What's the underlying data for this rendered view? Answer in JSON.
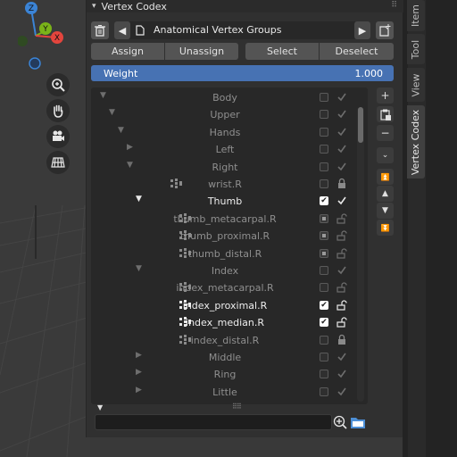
{
  "panel": {
    "title": "Vertex Codex"
  },
  "gizmo": {
    "z": "Z",
    "y": "Y",
    "x": "X"
  },
  "side_tabs": [
    "Item",
    "Tool",
    "View",
    "Vertex Codex"
  ],
  "selector": {
    "name": "Anatomical Vertex Groups"
  },
  "actions": {
    "assign": "Assign",
    "unassign": "Unassign",
    "select": "Select",
    "deselect": "Deselect"
  },
  "weight": {
    "label": "Weight",
    "value": "1.000"
  },
  "tree": [
    {
      "label": "Body",
      "indent": 0,
      "expanded": true,
      "kind": "folder",
      "checked": false,
      "locked": false,
      "active": false
    },
    {
      "label": "Upper",
      "indent": 1,
      "expanded": true,
      "kind": "folder",
      "checked": false,
      "locked": false,
      "active": false
    },
    {
      "label": "Hands",
      "indent": 2,
      "expanded": true,
      "kind": "folder",
      "checked": false,
      "locked": false,
      "active": false
    },
    {
      "label": "Left",
      "indent": 3,
      "expanded": false,
      "kind": "folder",
      "checked": false,
      "locked": false,
      "active": false
    },
    {
      "label": "Right",
      "indent": 3,
      "expanded": true,
      "kind": "folder",
      "checked": false,
      "locked": false,
      "active": false
    },
    {
      "label": "wrist.R",
      "indent": 4,
      "kind": "group",
      "checked": false,
      "locked": true,
      "active": false
    },
    {
      "label": "Thumb",
      "indent": 4,
      "expanded": true,
      "kind": "folder",
      "checked": true,
      "locked": false,
      "active": true
    },
    {
      "label": "thumb_metacarpal.R",
      "indent": 5,
      "kind": "group",
      "checked": "mixed",
      "locked": false,
      "active": false
    },
    {
      "label": "thumb_proximal.R",
      "indent": 5,
      "kind": "group",
      "checked": "mixed",
      "locked": false,
      "active": false
    },
    {
      "label": "thumb_distal.R",
      "indent": 5,
      "kind": "group",
      "checked": "mixed",
      "locked": false,
      "active": false
    },
    {
      "label": "Index",
      "indent": 4,
      "expanded": true,
      "kind": "folder",
      "checked": false,
      "locked": false,
      "active": false
    },
    {
      "label": "index_metacarpal.R",
      "indent": 5,
      "kind": "group",
      "checked": false,
      "locked": false,
      "active": false
    },
    {
      "label": "index_proximal.R",
      "indent": 5,
      "kind": "group",
      "checked": true,
      "locked": false,
      "active": true
    },
    {
      "label": "index_median.R",
      "indent": 5,
      "kind": "group",
      "checked": true,
      "locked": false,
      "active": true
    },
    {
      "label": "index_distal.R",
      "indent": 5,
      "kind": "group",
      "checked": false,
      "locked": true,
      "active": false
    },
    {
      "label": "Middle",
      "indent": 4,
      "expanded": false,
      "kind": "folder",
      "checked": false,
      "locked": false,
      "active": false
    },
    {
      "label": "Ring",
      "indent": 4,
      "expanded": false,
      "kind": "folder",
      "checked": false,
      "locked": false,
      "active": false
    },
    {
      "label": "Little",
      "indent": 4,
      "expanded": false,
      "kind": "folder",
      "checked": false,
      "locked": false,
      "active": false
    }
  ],
  "filter": {
    "value": ""
  },
  "colors": {
    "accent": "#4772b3",
    "axis_x": "#e3453d",
    "axis_y": "#7ab319",
    "axis_z": "#3b84d6"
  }
}
